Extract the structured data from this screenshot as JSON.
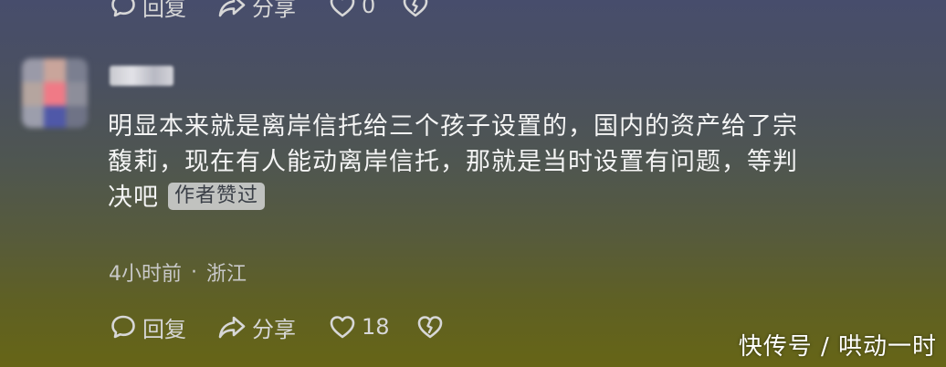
{
  "top_actions": {
    "reply_label": "回复",
    "share_label": "分享",
    "like_count": "0"
  },
  "comment": {
    "text_lines": [
      "明显本来就是离岸信托给三个孩子设置的，国内的资产给了宗",
      "馥莉，现在有人能动离岸信托，那就是当时设置有问题，等判",
      "决吧"
    ],
    "author_liked_badge": "作者赞过",
    "time": "4小时前",
    "separator": "·",
    "location": "浙江"
  },
  "bottom_actions": {
    "reply_label": "回复",
    "share_label": "分享",
    "like_count": "18"
  },
  "watermark": "快传号 / 哄动一时",
  "icons": {
    "reply": "comment-bubble-icon",
    "share": "share-arrow-icon",
    "like": "heart-icon",
    "dislike": "broken-heart-icon"
  },
  "colors": {
    "text": "#f4f4f4",
    "muted": "#c9c9c9",
    "badge_bg": "#e6e6e8"
  }
}
